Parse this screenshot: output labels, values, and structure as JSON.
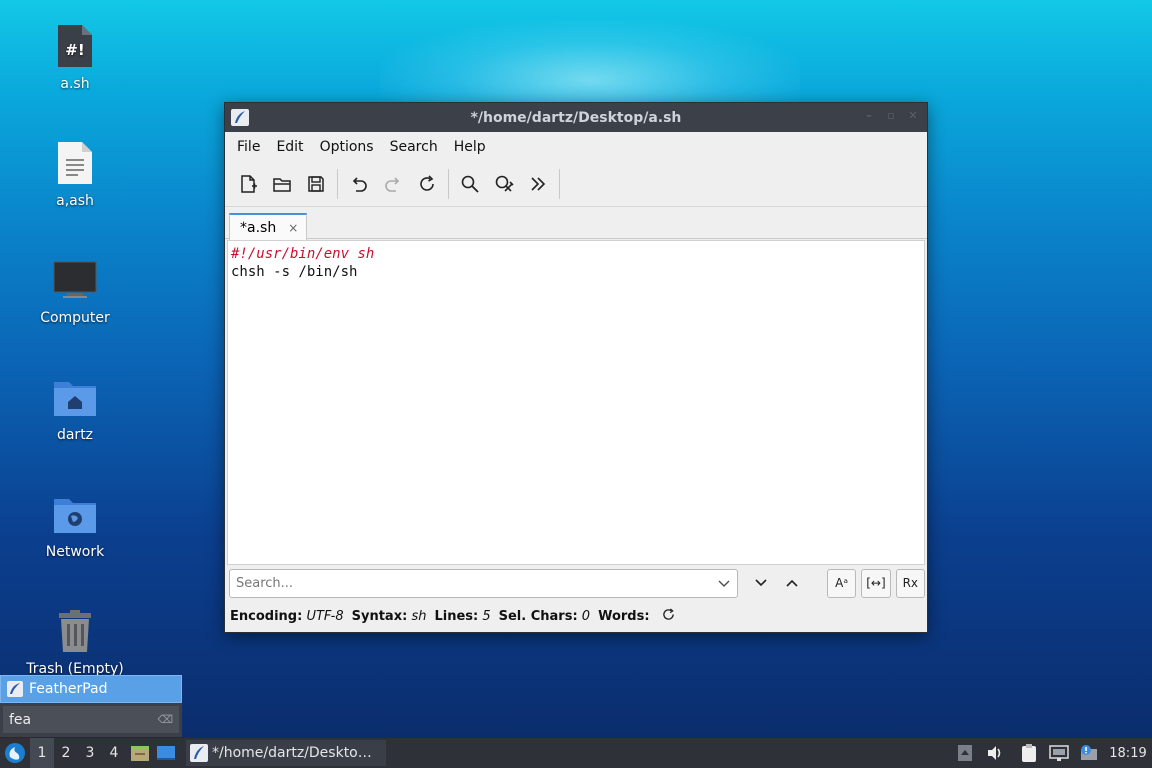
{
  "desktop": {
    "icons": [
      {
        "label": "a.sh",
        "glyph": "#!"
      },
      {
        "label": "a,ash"
      },
      {
        "label": "Computer"
      },
      {
        "label": "dartz"
      },
      {
        "label": "Network"
      },
      {
        "label": "Trash (Empty)"
      }
    ]
  },
  "window": {
    "title": "*/home/dartz/Desktop/a.sh",
    "menu": [
      "File",
      "Edit",
      "Options",
      "Search",
      "Help"
    ],
    "tab": {
      "label": "*a.sh",
      "close": "×"
    },
    "editor_lines": [
      "#!/usr/bin/env sh",
      "chsh -s /bin/sh"
    ],
    "search": {
      "placeholder": "Search..."
    },
    "search_options": [
      "Aᵃ",
      "[↔]",
      "Rx"
    ],
    "status": {
      "encoding_label": "Encoding:",
      "encoding": "UTF-8",
      "syntax_label": "Syntax:",
      "syntax": "sh",
      "lines_label": "Lines:",
      "lines": "5",
      "selchars_label": "Sel. Chars:",
      "selchars": "0",
      "words_label": "Words:"
    }
  },
  "launcher": {
    "result": "FeatherPad",
    "query": "fea"
  },
  "taskbar": {
    "workspaces": [
      "1",
      "2",
      "3",
      "4"
    ],
    "active_workspace": "1",
    "task_title": "*/home/dartz/Deskto…",
    "clock": "18:19"
  },
  "colors": {
    "shebang": "#c8102e",
    "titlebar": "#3c4049",
    "taskbar": "#2e3138",
    "launcher_highlight": "#5aa0e6"
  }
}
